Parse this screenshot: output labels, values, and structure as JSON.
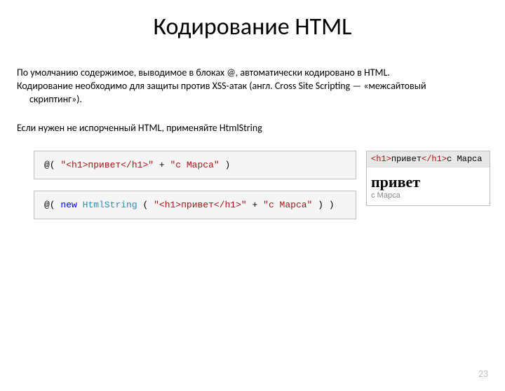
{
  "title": "Кодирование HTML",
  "para1_line1": "По умолчанию содержимое, выводимое в блоках @, автоматически кодировано в HTML.",
  "para1_line2": "Кодирование необходимо для защиты против XSS-атак (англ. Cross Site Scripting — «межсайтовый",
  "para1_line3": "скриптинг»).",
  "para2": "Если нужен не испорченный HTML, применяйте HtmlString",
  "code1": {
    "at": "@(",
    "str1": "\"<h1>привет</h1>\"",
    "plus": " + ",
    "str2": "\"с Марса\"",
    "close": ")"
  },
  "code2": {
    "at": "@(",
    "new": " new",
    "type": " HtmlString",
    "open": "(",
    "str1": "\"<h1>привет</h1>\"",
    "plus": " + ",
    "str2": "\"с Марса\"",
    "close": ") )"
  },
  "render": {
    "raw_open": "<h1>",
    "raw_text": "привет",
    "raw_close": "</h1>",
    "raw_tail": "с Марса",
    "h1": "привет",
    "sub": "с Марса"
  },
  "page_number": "23"
}
